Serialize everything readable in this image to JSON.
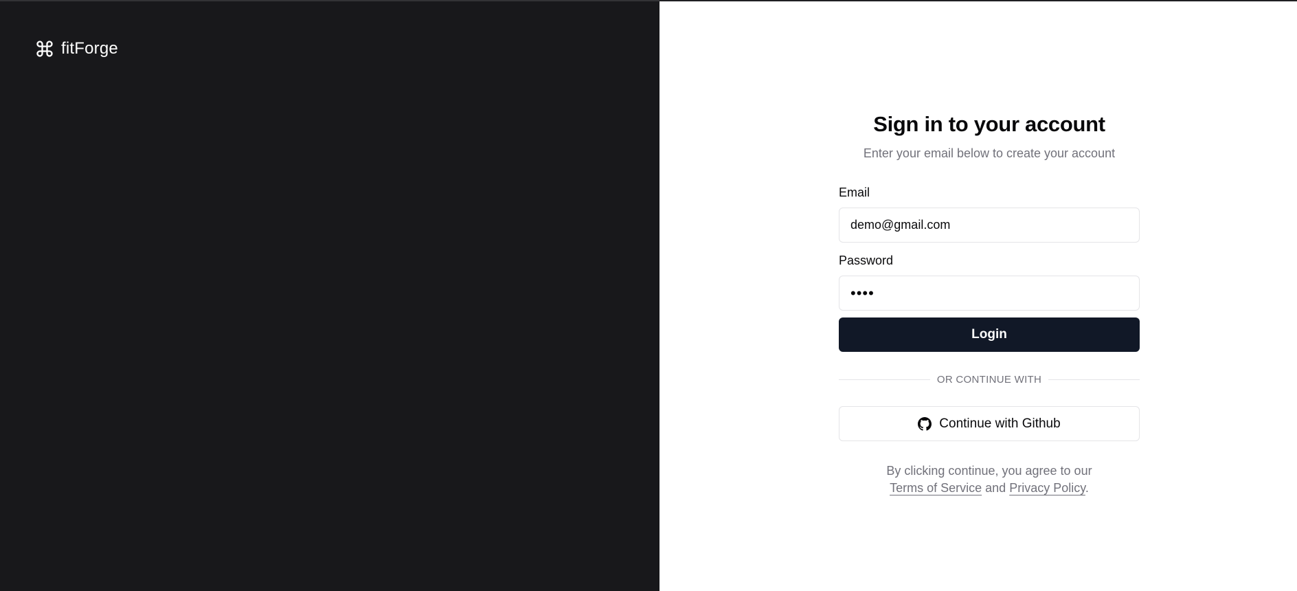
{
  "brand": {
    "name": "fitForge",
    "icon": "command-icon"
  },
  "auth": {
    "title": "Sign in to your account",
    "subtitle": "Enter your email below to create your account",
    "email": {
      "label": "Email",
      "value": "demo@gmail.com"
    },
    "password": {
      "label": "Password",
      "value": "••••"
    },
    "login_label": "Login",
    "divider_text": "OR CONTINUE WITH",
    "github_label": "Continue with Github",
    "github_icon": "github-icon",
    "legal": {
      "prefix": "By clicking continue, you agree to our",
      "terms": "Terms of Service",
      "conjunction": "and",
      "privacy": "Privacy Policy",
      "suffix": "."
    }
  },
  "colors": {
    "left_panel_bg": "#18181b",
    "primary_button_bg": "#111827",
    "muted_text": "#71717a",
    "border": "#e4e4e7"
  }
}
